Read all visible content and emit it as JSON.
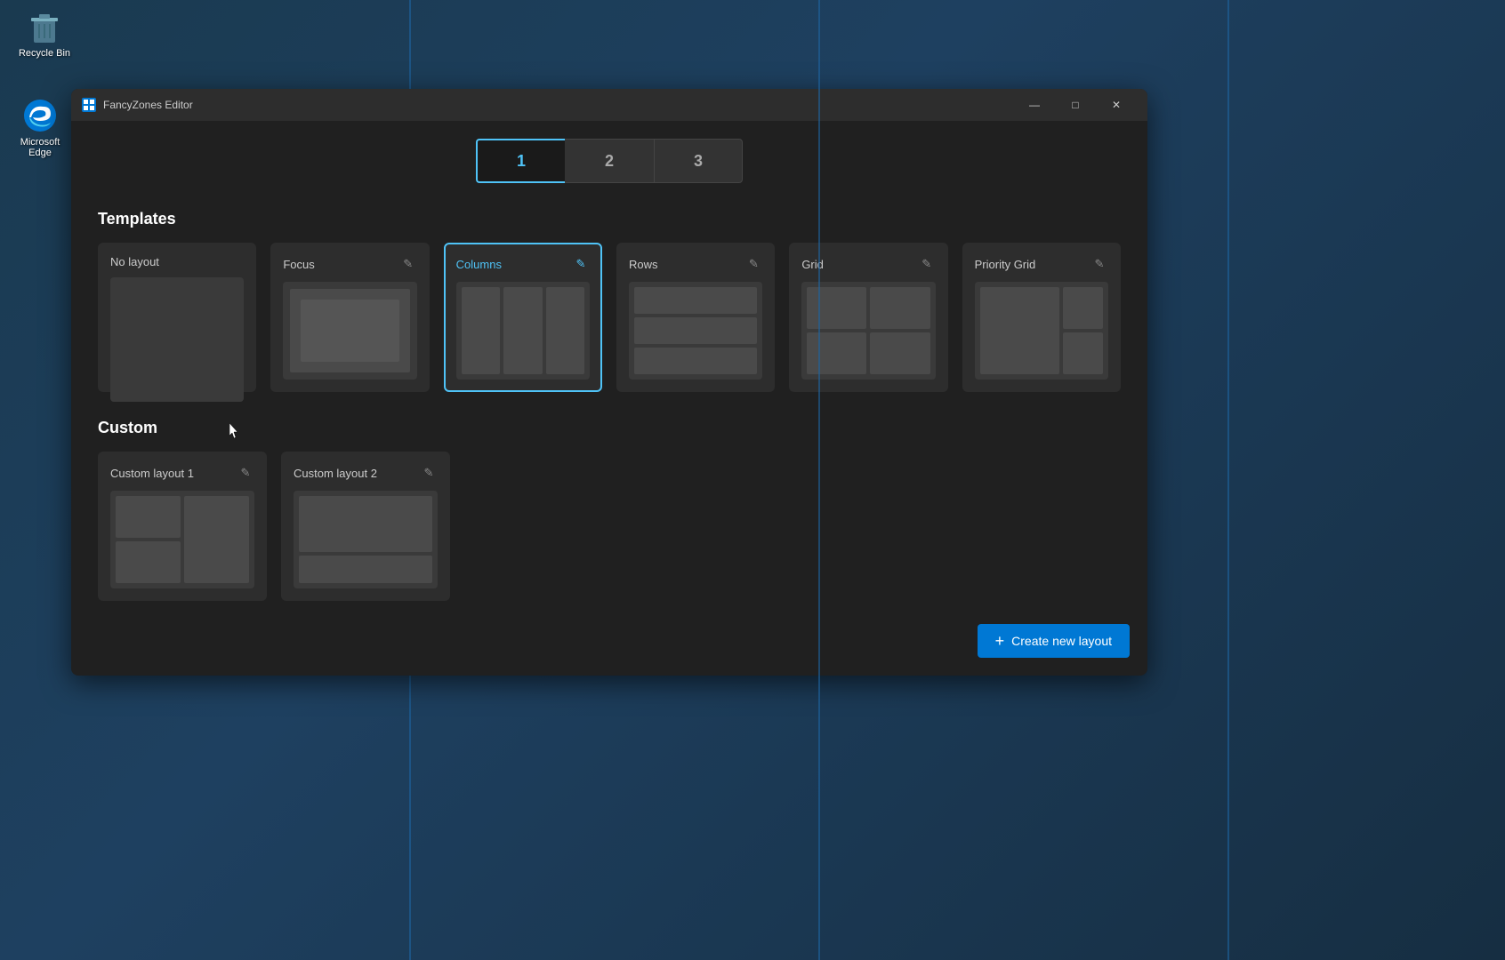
{
  "desktop": {
    "recycle_bin_label": "Recycle Bin",
    "edge_label": "Microsoft\nEdge"
  },
  "window": {
    "title": "FancyZones Editor",
    "minimize_label": "—",
    "restore_label": "□",
    "close_label": "✕"
  },
  "monitors": [
    {
      "id": "1",
      "label": "1",
      "active": true
    },
    {
      "id": "2",
      "label": "2",
      "active": false
    },
    {
      "id": "3",
      "label": "3",
      "active": false
    }
  ],
  "templates_section": {
    "title": "Templates"
  },
  "templates": [
    {
      "id": "no-layout",
      "name": "No layout",
      "selected": false,
      "editable": false
    },
    {
      "id": "focus",
      "name": "Focus",
      "selected": false,
      "editable": true
    },
    {
      "id": "columns",
      "name": "Columns",
      "selected": true,
      "editable": true
    },
    {
      "id": "rows",
      "name": "Rows",
      "selected": false,
      "editable": true
    },
    {
      "id": "grid",
      "name": "Grid",
      "selected": false,
      "editable": true
    },
    {
      "id": "priority-grid",
      "name": "Priority Grid",
      "selected": false,
      "editable": true
    }
  ],
  "custom_section": {
    "title": "Custom"
  },
  "custom_layouts": [
    {
      "id": "custom1",
      "name": "Custom layout 1",
      "editable": true
    },
    {
      "id": "custom2",
      "name": "Custom layout 2",
      "editable": true
    }
  ],
  "create_button": {
    "label": "Create new layout",
    "plus": "+"
  },
  "edit_icon": "✎",
  "colors": {
    "accent": "#4fc3f7",
    "accent_dark": "#0078d4",
    "selected_border": "#4fc3f7"
  }
}
